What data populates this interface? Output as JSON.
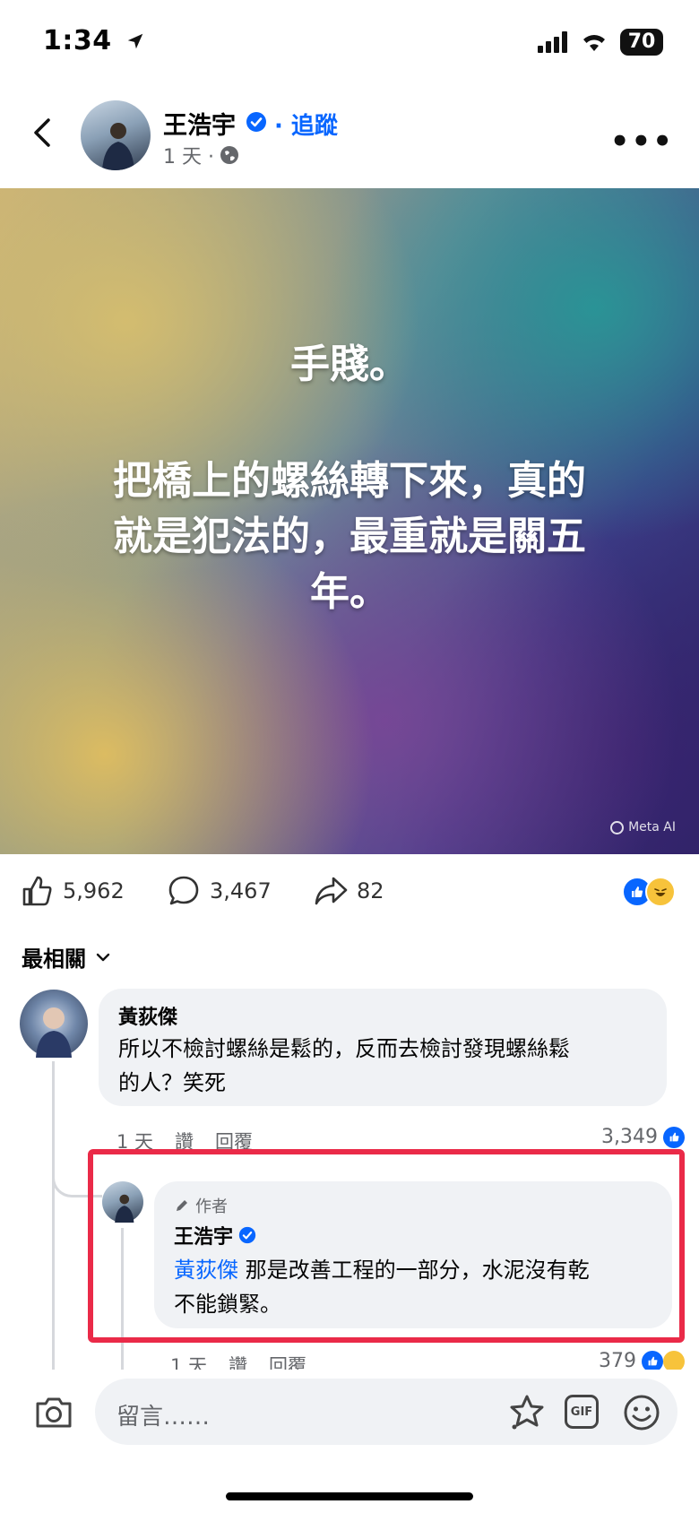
{
  "status_bar": {
    "time": "1:34",
    "battery": "70"
  },
  "header": {
    "author": "王浩宇",
    "follow": "· 追蹤",
    "time": "1 天 ·",
    "icons": {
      "back": "back-chevron-icon",
      "verified": "verified-badge-icon",
      "privacy": "globe-icon",
      "more": "more-options-icon"
    }
  },
  "post": {
    "lines": [
      "手賤。",
      "把橋上的螺絲轉下來，真的",
      "就是犯法的，最重就是關五",
      "年。"
    ],
    "watermark": "Meta AI",
    "colors": {
      "text": "#ffffff"
    }
  },
  "actions": {
    "likes": "5,962",
    "comments": "3,467",
    "shares": "82"
  },
  "sort": {
    "label": "最相關"
  },
  "comments": [
    {
      "name": "黃荻傑",
      "text_lines": [
        "所以不檢討螺絲是鬆的，反而去檢討發現螺絲鬆",
        "的人？笑死"
      ],
      "time": "1 天",
      "like": "讚",
      "reply": "回覆",
      "reactions": "3,349"
    },
    {
      "badge": "作者",
      "name": "王浩宇",
      "mention": "黃荻傑",
      "text_line1": " 那是改善工程的一部分，水泥沒有乾",
      "text_line2": "不能鎖緊。",
      "time": "1 天",
      "like": "讚",
      "reply": "回覆",
      "reactions": "379"
    }
  ],
  "composer": {
    "placeholder": "留言……",
    "gif": "GIF"
  },
  "colors": {
    "accent": "#0866ff",
    "highlight_border": "#ea2a48",
    "bubble": "#f0f2f5",
    "muted": "#65676b"
  }
}
